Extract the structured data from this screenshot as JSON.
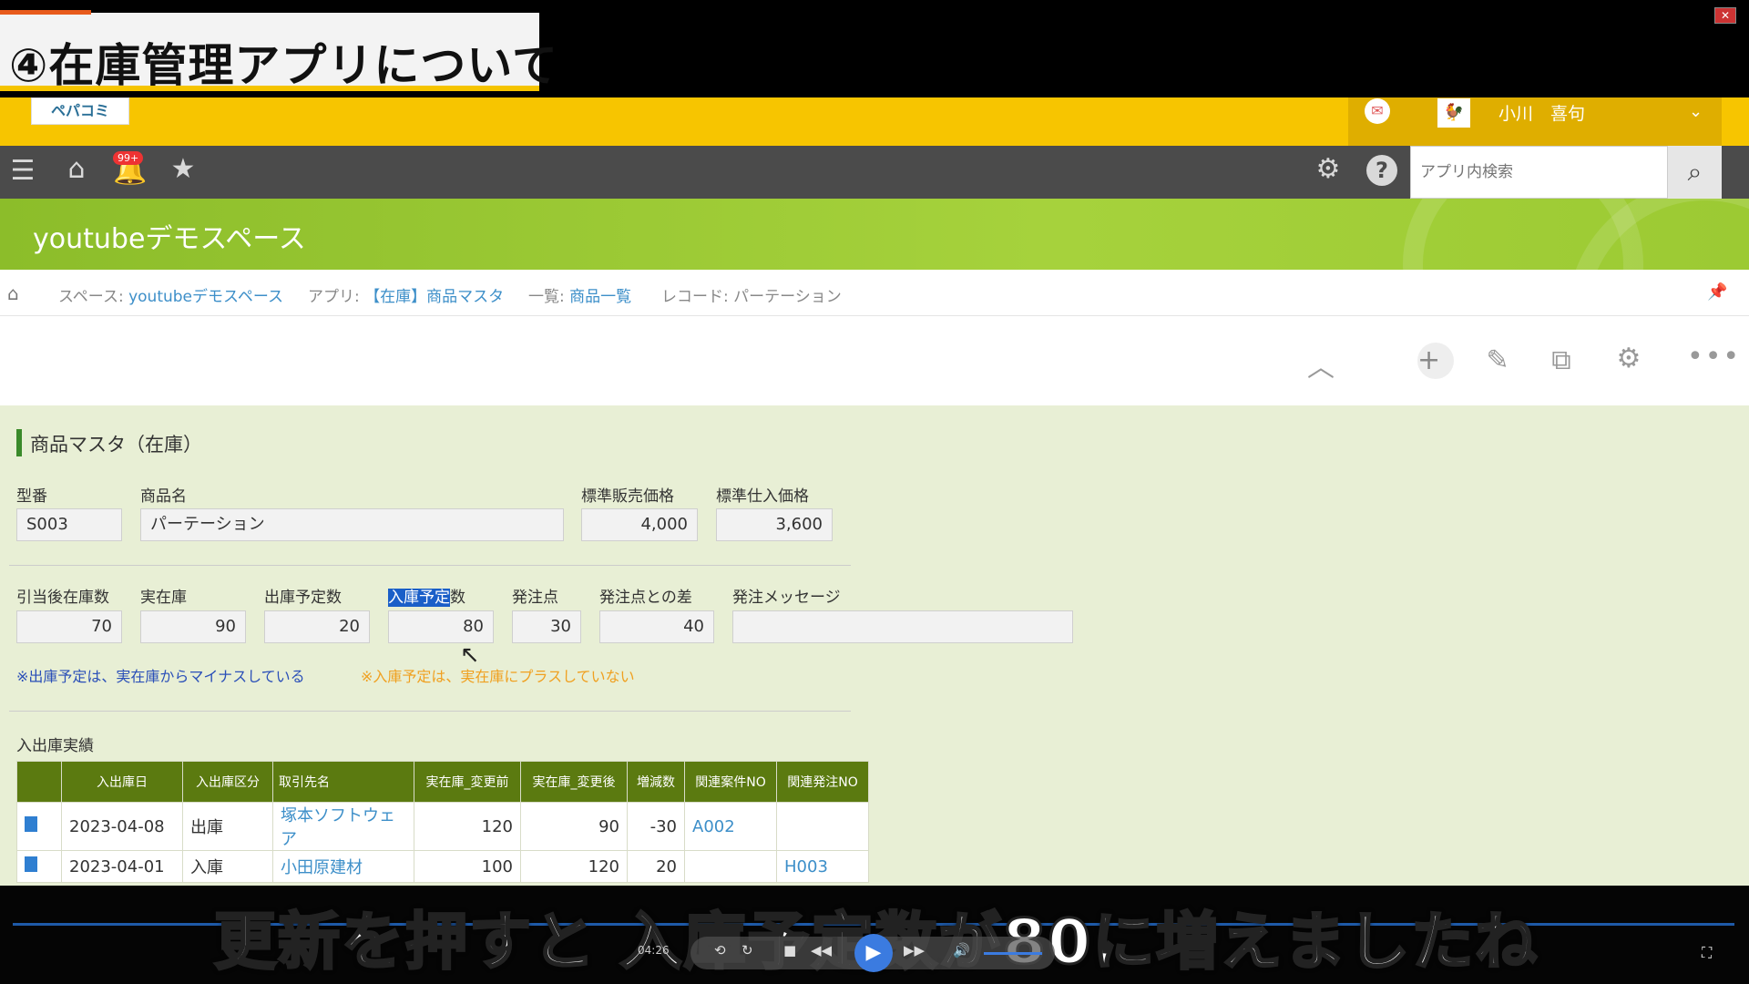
{
  "video": {
    "title": "④在庫管理アプリについて",
    "subtitle": "更新を押すと 入庫予定数が80に増えましたね",
    "timestamp": "04:26",
    "close_glyph": "✕",
    "fullscreen_glyph": "⛶"
  },
  "header": {
    "logo_text": "ペパコミ",
    "user_name": "小川　喜句",
    "notifications_badge": "99+"
  },
  "nav": {
    "search_placeholder": "アプリ内検索"
  },
  "space": {
    "title": "youtubeデモスペース"
  },
  "breadcrumb": {
    "space_prefix": "スペース: ",
    "space": "youtubeデモスペース",
    "app_prefix": "アプリ: ",
    "app": "【在庫】商品マスタ",
    "view_prefix": "一覧: ",
    "view": "商品一覧",
    "record": "レコード: パーテーション"
  },
  "record": {
    "section_title": "商品マスタ（在庫）",
    "labels": {
      "model_no": "型番",
      "product_name": "商品名",
      "std_sale_price": "標準販売価格",
      "std_purchase_price": "標準仕入価格",
      "stock_after_alloc": "引当後在庫数",
      "actual_stock": "実在庫",
      "planned_out": "出庫予定数",
      "planned_in_highlight": "入庫予定",
      "planned_in_rest": "数",
      "order_point": "発注点",
      "order_point_diff": "発注点との差",
      "order_message": "発注メッセージ"
    },
    "values": {
      "model_no": "S003",
      "product_name": "パーテーション",
      "std_sale_price": "4,000",
      "std_purchase_price": "3,600",
      "stock_after_alloc": "70",
      "actual_stock": "90",
      "planned_out": "20",
      "planned_in": "80",
      "order_point": "30",
      "order_point_diff": "40",
      "order_message": ""
    },
    "notes": {
      "blue": "※出庫予定は、実在庫からマイナスしている",
      "orange": "※入庫予定は、実在庫にプラスしていない"
    },
    "table_title": "入出庫実績",
    "table": {
      "headers": [
        "入出庫日",
        "入出庫区分",
        "取引先名",
        "実在庫_変更前",
        "実在庫_変更後",
        "増減数",
        "関連案件NO",
        "関連発注NO"
      ],
      "rows": [
        {
          "date": "2023-04-08",
          "type": "出庫",
          "partner": "塚本ソフトウェア",
          "before": "120",
          "after": "90",
          "delta": "-30",
          "case_no": "A002",
          "order_no": ""
        },
        {
          "date": "2023-04-01",
          "type": "入庫",
          "partner": "小田原建材",
          "before": "100",
          "after": "120",
          "delta": "20",
          "case_no": "",
          "order_no": "H003"
        }
      ]
    }
  },
  "colors": {
    "header_yellow": "#f7c500",
    "nav_gray": "#4b4b4b",
    "banner_green": "#9cca33",
    "table_header_green": "#5b7a10",
    "record_bg": "#e8efd5",
    "link_blue": "#3d8fc9",
    "note_orange": "#f0a020",
    "note_blue": "#2a4fb8"
  },
  "icons": {
    "menu": "menu-icon",
    "home": "home-icon",
    "bell": "bell-icon",
    "star": "star-icon",
    "gear": "gear-icon",
    "help": "help-icon",
    "search": "search-icon"
  }
}
